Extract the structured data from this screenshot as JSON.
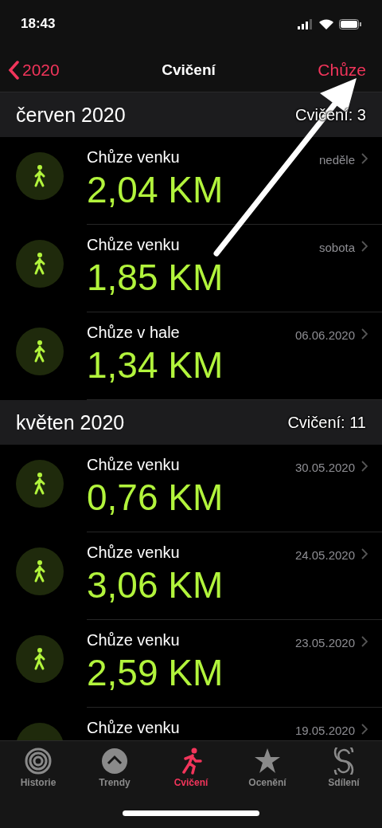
{
  "status_bar": {
    "time": "18:43"
  },
  "nav": {
    "back": "2020",
    "title": "Cvičení",
    "action": "Chůze"
  },
  "sections": [
    {
      "title": "červen 2020",
      "count": "Cvičení: 3",
      "workouts": [
        {
          "name": "Chůze venku",
          "distance": "2,04 KM",
          "date": "neděle"
        },
        {
          "name": "Chůze venku",
          "distance": "1,85 KM",
          "date": "sobota"
        },
        {
          "name": "Chůze v hale",
          "distance": "1,34 KM",
          "date": "06.06.2020"
        }
      ]
    },
    {
      "title": "květen 2020",
      "count": "Cvičení: 11",
      "workouts": [
        {
          "name": "Chůze venku",
          "distance": "0,76 KM",
          "date": "30.05.2020"
        },
        {
          "name": "Chůze venku",
          "distance": "3,06 KM",
          "date": "24.05.2020"
        },
        {
          "name": "Chůze venku",
          "distance": "2,59 KM",
          "date": "23.05.2020"
        },
        {
          "name": "Chůze venku",
          "date": "19.05.2020"
        }
      ]
    }
  ],
  "tabs": [
    {
      "kind": "history",
      "label": "Historie",
      "selected": false
    },
    {
      "kind": "trends",
      "label": "Trendy",
      "selected": false
    },
    {
      "kind": "workouts",
      "label": "Cvičení",
      "selected": true
    },
    {
      "kind": "awards",
      "label": "Ocenění",
      "selected": false
    },
    {
      "kind": "sharing",
      "label": "Sdílení",
      "selected": false
    }
  ]
}
